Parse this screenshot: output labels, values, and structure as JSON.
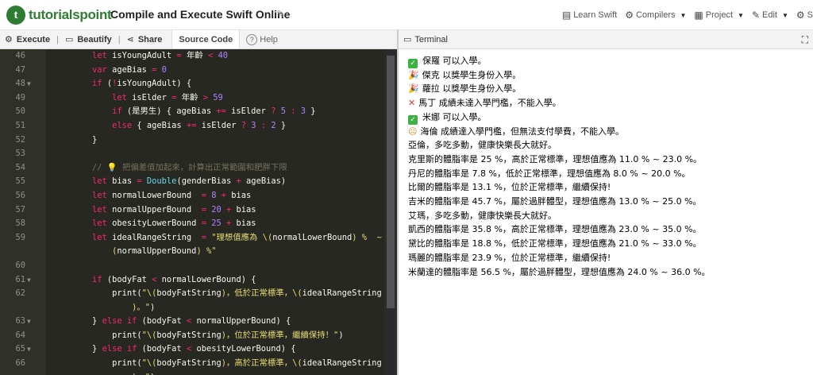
{
  "header": {
    "logo_text": "tutorialspoint",
    "logo_mark": "t",
    "title": "Compile and Execute Swift Online",
    "nav": [
      {
        "label": "Learn Swift",
        "icon": "book-icon",
        "caret": false
      },
      {
        "label": "Compilers",
        "icon": "gear-icon",
        "caret": true
      },
      {
        "label": "Project",
        "icon": "folder-icon",
        "caret": true
      },
      {
        "label": "Edit",
        "icon": "pencil-icon",
        "caret": true
      },
      {
        "label": "S",
        "icon": "gear-icon",
        "caret": false
      }
    ]
  },
  "toolbar": {
    "execute": "Execute",
    "beautify": "Beautify",
    "share": "Share",
    "source_code": "Source Code",
    "help": "Help"
  },
  "terminal": {
    "title": "Terminal",
    "lines": [
      {
        "icon": "check",
        "text": "保羅 可以入學。"
      },
      {
        "icon": "party",
        "text": "傑克 以獎學生身份入學。"
      },
      {
        "icon": "party",
        "text": "蘿拉 以獎學生身份入學。"
      },
      {
        "icon": "x",
        "text": "馬丁 成績未達入學門檻，不能入學。"
      },
      {
        "icon": "check",
        "text": "米娜 可以入學。"
      },
      {
        "icon": "flushed",
        "text": "海倫 成績達入學門檻，但無法支付學費，不能入學。"
      },
      {
        "icon": "",
        "text": "亞倫，多吃多動，健康快樂長大就好。"
      },
      {
        "icon": "",
        "text": "克里斯的體脂率是 25 %，高於正常標準，理想值應為 11.0 % ~ 23.0 %。"
      },
      {
        "icon": "",
        "text": "丹尼的體脂率是 7.8 %，低於正常標準，理想值應為 8.0 % ~ 20.0 %。"
      },
      {
        "icon": "",
        "text": "比爾的體脂率是 13.1 %，位於正常標準，繼續保持!"
      },
      {
        "icon": "",
        "text": "吉米的體脂率是 45.7 %，屬於過胖體型，理想值應為 13.0 % ~ 25.0 %。"
      },
      {
        "icon": "",
        "text": "艾瑪，多吃多動，健康快樂長大就好。"
      },
      {
        "icon": "",
        "text": "凱西的體脂率是 35.8 %，高於正常標準，理想值應為 23.0 % ~ 35.0 %。"
      },
      {
        "icon": "",
        "text": "黛比的體脂率是 18.8 %，低於正常標準，理想值應為 21.0 % ~ 33.0 %。"
      },
      {
        "icon": "",
        "text": "瑪麗的體脂率是 23.9 %，位於正常標準，繼續保持!"
      },
      {
        "icon": "",
        "text": "米蘭達的體脂率是 56.5 %，屬於過胖體型，理想值應為 24.0 % ~ 36.0 %。"
      }
    ]
  },
  "editor": {
    "lines": [
      {
        "n": "46",
        "fold": false,
        "tokens": [
          [
            "",
            "        "
          ],
          [
            "kw",
            "let"
          ],
          [
            "",
            " isYoungAdult "
          ],
          [
            "op",
            "="
          ],
          [
            "",
            " 年齡 "
          ],
          [
            "op",
            "<"
          ],
          [
            "",
            " "
          ],
          [
            "num",
            "40"
          ]
        ]
      },
      {
        "n": "47",
        "fold": false,
        "tokens": [
          [
            "",
            "        "
          ],
          [
            "kw",
            "var"
          ],
          [
            "",
            " ageBias "
          ],
          [
            "op",
            "="
          ],
          [
            "",
            " "
          ],
          [
            "num",
            "0"
          ]
        ]
      },
      {
        "n": "48",
        "fold": true,
        "tokens": [
          [
            "",
            "        "
          ],
          [
            "kw",
            "if"
          ],
          [
            "",
            " ("
          ],
          [
            "op",
            "!"
          ],
          [
            "",
            "isYoungAdult) {"
          ]
        ]
      },
      {
        "n": "49",
        "fold": false,
        "tokens": [
          [
            "",
            "            "
          ],
          [
            "kw",
            "let"
          ],
          [
            "",
            " isElder "
          ],
          [
            "op",
            "="
          ],
          [
            "",
            " 年齡 "
          ],
          [
            "op",
            ">"
          ],
          [
            "",
            " "
          ],
          [
            "num",
            "59"
          ]
        ]
      },
      {
        "n": "50",
        "fold": false,
        "tokens": [
          [
            "",
            "            "
          ],
          [
            "kw",
            "if"
          ],
          [
            "",
            " (是男生) { ageBias "
          ],
          [
            "op",
            "+="
          ],
          [
            "",
            " isElder "
          ],
          [
            "op",
            "?"
          ],
          [
            "",
            " "
          ],
          [
            "num",
            "5"
          ],
          [
            "",
            " "
          ],
          [
            "op",
            ":"
          ],
          [
            "",
            " "
          ],
          [
            "num",
            "3"
          ],
          [
            "",
            " }"
          ]
        ]
      },
      {
        "n": "51",
        "fold": false,
        "tokens": [
          [
            "",
            "            "
          ],
          [
            "kw",
            "else"
          ],
          [
            "",
            " { ageBias "
          ],
          [
            "op",
            "+="
          ],
          [
            "",
            " isElder "
          ],
          [
            "op",
            "?"
          ],
          [
            "",
            " "
          ],
          [
            "num",
            "3"
          ],
          [
            "",
            " "
          ],
          [
            "op",
            ":"
          ],
          [
            "",
            " "
          ],
          [
            "num",
            "2"
          ],
          [
            "",
            " }"
          ]
        ]
      },
      {
        "n": "52",
        "fold": false,
        "tokens": [
          [
            "",
            "        }"
          ]
        ]
      },
      {
        "n": "53",
        "fold": false,
        "tokens": [
          [
            "",
            ""
          ]
        ]
      },
      {
        "n": "54",
        "fold": false,
        "tokens": [
          [
            "",
            "        "
          ],
          [
            "cm",
            "// 💡 把偏差值加起來，計算出正常範圍和肥胖下限"
          ]
        ]
      },
      {
        "n": "55",
        "fold": false,
        "tokens": [
          [
            "",
            "        "
          ],
          [
            "kw",
            "let"
          ],
          [
            "",
            " bias "
          ],
          [
            "op",
            "="
          ],
          [
            "",
            " "
          ],
          [
            "ty",
            "Double"
          ],
          [
            "",
            "(genderBias "
          ],
          [
            "op",
            "+"
          ],
          [
            "",
            " ageBias)"
          ]
        ]
      },
      {
        "n": "56",
        "fold": false,
        "tokens": [
          [
            "",
            "        "
          ],
          [
            "kw",
            "let"
          ],
          [
            "",
            " normalLowerBound  "
          ],
          [
            "op",
            "="
          ],
          [
            "",
            " "
          ],
          [
            "num",
            "8"
          ],
          [
            "",
            " "
          ],
          [
            "op",
            "+"
          ],
          [
            "",
            " bias"
          ]
        ]
      },
      {
        "n": "57",
        "fold": false,
        "tokens": [
          [
            "",
            "        "
          ],
          [
            "kw",
            "let"
          ],
          [
            "",
            " normalUpperBound  "
          ],
          [
            "op",
            "="
          ],
          [
            "",
            " "
          ],
          [
            "num",
            "20"
          ],
          [
            "",
            " "
          ],
          [
            "op",
            "+"
          ],
          [
            "",
            " bias"
          ]
        ]
      },
      {
        "n": "58",
        "fold": false,
        "tokens": [
          [
            "",
            "        "
          ],
          [
            "kw",
            "let"
          ],
          [
            "",
            " obesityLowerBound "
          ],
          [
            "op",
            "="
          ],
          [
            "",
            " "
          ],
          [
            "num",
            "25"
          ],
          [
            "",
            " "
          ],
          [
            "op",
            "+"
          ],
          [
            "",
            " bias"
          ]
        ]
      },
      {
        "n": "59",
        "fold": false,
        "tokens": [
          [
            "",
            "        "
          ],
          [
            "kw",
            "let"
          ],
          [
            "",
            " idealRangeString  "
          ],
          [
            "op",
            "="
          ],
          [
            "",
            " "
          ],
          [
            "str",
            "\"理想值應為 \\("
          ],
          [
            "",
            "normalLowerBound"
          ],
          [
            "str",
            ") %  ~ \\"
          ]
        ]
      },
      {
        "n": "",
        "fold": false,
        "tokens": [
          [
            "",
            "            "
          ],
          [
            "str",
            "("
          ],
          [
            "",
            "normalUpperBound"
          ],
          [
            "str",
            ") %\""
          ]
        ]
      },
      {
        "n": "60",
        "fold": false,
        "tokens": [
          [
            "",
            ""
          ]
        ]
      },
      {
        "n": "61",
        "fold": true,
        "tokens": [
          [
            "",
            "        "
          ],
          [
            "kw",
            "if"
          ],
          [
            "",
            " (bodyFat "
          ],
          [
            "op",
            "<"
          ],
          [
            "",
            " normalLowerBound) {"
          ]
        ]
      },
      {
        "n": "62",
        "fold": false,
        "tokens": [
          [
            "",
            "            print("
          ],
          [
            "str",
            "\"\\("
          ],
          [
            "",
            "bodyFatString"
          ],
          [
            "str",
            ")，低於正常標準，\\("
          ],
          [
            "",
            "idealRangeString"
          ]
        ]
      },
      {
        "n": "",
        "fold": false,
        "tokens": [
          [
            "",
            "                "
          ],
          [
            "str",
            ")。\""
          ],
          [
            "",
            ")"
          ]
        ]
      },
      {
        "n": "63",
        "fold": true,
        "tokens": [
          [
            "",
            "        } "
          ],
          [
            "kw",
            "else if"
          ],
          [
            "",
            " (bodyFat "
          ],
          [
            "op",
            "<"
          ],
          [
            "",
            " normalUpperBound) {"
          ]
        ]
      },
      {
        "n": "64",
        "fold": false,
        "tokens": [
          [
            "",
            "            print("
          ],
          [
            "str",
            "\"\\("
          ],
          [
            "",
            "bodyFatString"
          ],
          [
            "str",
            ")，位於正常標準，繼續保持！\""
          ],
          [
            "",
            ")"
          ]
        ]
      },
      {
        "n": "65",
        "fold": true,
        "tokens": [
          [
            "",
            "        } "
          ],
          [
            "kw",
            "else if"
          ],
          [
            "",
            " (bodyFat "
          ],
          [
            "op",
            "<"
          ],
          [
            "",
            " obesityLowerBound) {"
          ]
        ]
      },
      {
        "n": "66",
        "fold": false,
        "tokens": [
          [
            "",
            "            print("
          ],
          [
            "str",
            "\"\\("
          ],
          [
            "",
            "bodyFatString"
          ],
          [
            "str",
            ")，高於正常標準，\\("
          ],
          [
            "",
            "idealRangeString"
          ]
        ]
      },
      {
        "n": "",
        "fold": false,
        "tokens": [
          [
            "",
            "                "
          ],
          [
            "str",
            ")。\""
          ],
          [
            "",
            ")"
          ]
        ]
      }
    ]
  }
}
